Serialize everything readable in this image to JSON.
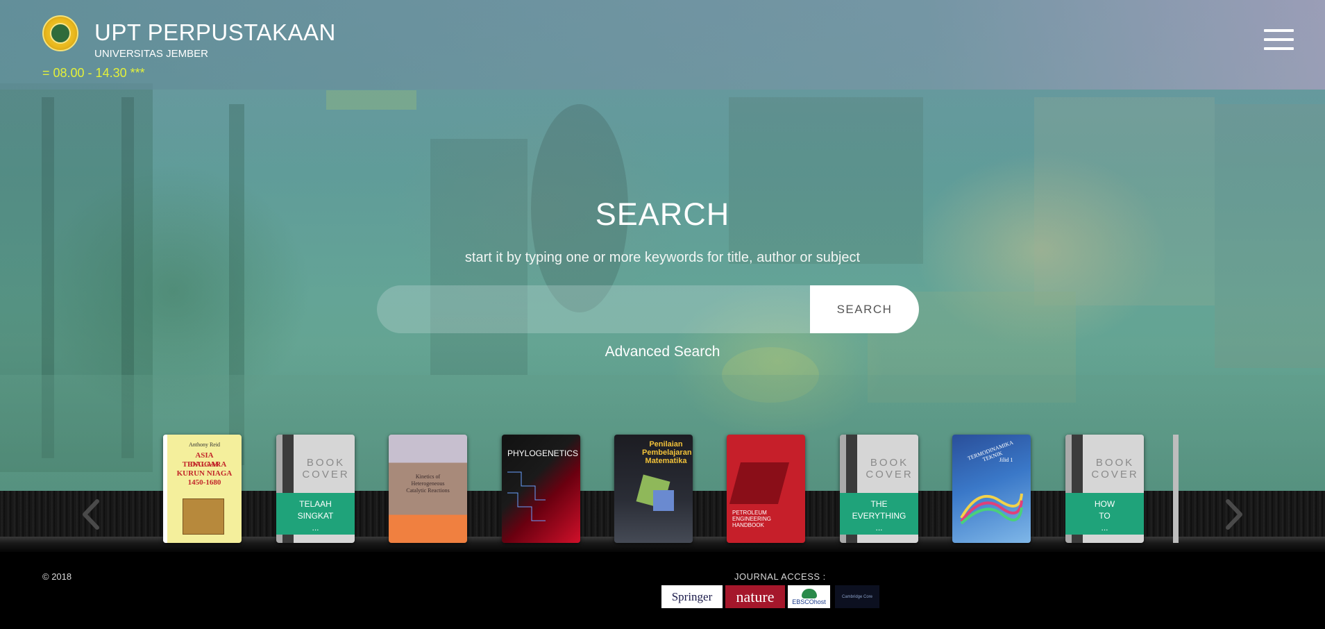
{
  "header": {
    "title": "UPT PERPUSTAKAAN",
    "subtitle": "UNIVERSITAS JEMBER",
    "hours": "= 08.00 - 14.30 ***"
  },
  "search": {
    "title": "SEARCH",
    "hint": "start it by typing one or more keywords for title, author or subject",
    "input_value": "",
    "input_placeholder": "",
    "button_label": "SEARCH",
    "advanced_label": "Advanced Search"
  },
  "books": [
    {
      "kind": "image",
      "title_lines": [
        "ASIA TENGGARA",
        "DALAM",
        "KURUN NIAGA",
        "1450-1680"
      ],
      "author": "Anthony Reid"
    },
    {
      "kind": "default",
      "placeholder": "BOOK COVER",
      "title_lines": [
        "TELAAH",
        "SINGKAT",
        "..."
      ]
    },
    {
      "kind": "image",
      "title_lines": [
        "Kinetics of",
        "Heterogeneous",
        "Catalytic Reactions"
      ]
    },
    {
      "kind": "image",
      "title_lines": [
        "PHYLOGENETICS"
      ]
    },
    {
      "kind": "image",
      "title_lines": [
        "Penilaian",
        "Pembelajaran",
        "Matematika"
      ]
    },
    {
      "kind": "image",
      "title_lines": [
        "PETROLEUM",
        "ENGINEERING",
        "HANDBOOK"
      ]
    },
    {
      "kind": "default",
      "placeholder": "BOOK COVER",
      "title_lines": [
        "THE",
        "EVERYTHING",
        "..."
      ]
    },
    {
      "kind": "image",
      "title_lines": [
        "TERMODINAMIKA TEKNIK",
        "Jilid 1"
      ]
    },
    {
      "kind": "default",
      "placeholder": "BOOK COVER",
      "title_lines": [
        "HOW",
        "TO",
        "..."
      ]
    }
  ],
  "footer": {
    "copyright": "© 2018",
    "journal_label": "JOURNAL ACCESS :",
    "journals": [
      "Springer",
      "nature",
      "EBSCOhost",
      "Cambridge Core"
    ]
  },
  "icons": {
    "menu": "hamburger-menu-icon",
    "prev": "chevron-left-icon",
    "next": "chevron-right-icon",
    "logo": "university-seal-logo"
  },
  "colors": {
    "accent_green": "#1fa37a",
    "hours_yellow": "#e3f03a",
    "search_button_bg": "#ffffff"
  }
}
